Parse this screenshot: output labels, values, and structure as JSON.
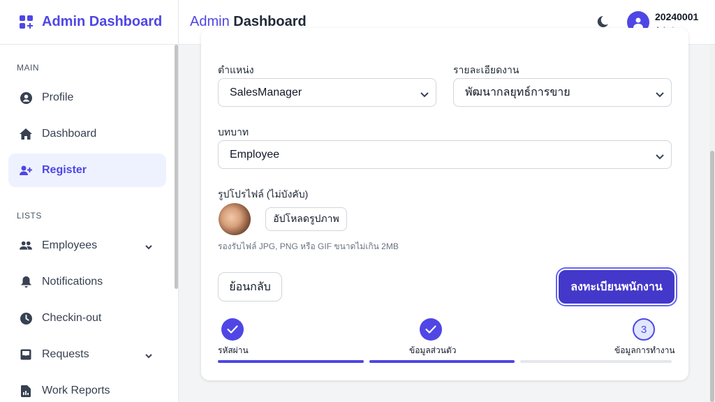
{
  "sidebar": {
    "brand": "Admin Dashboard",
    "sections": {
      "main": "MAIN",
      "lists": "LISTS"
    },
    "items": [
      {
        "label": "Profile",
        "icon": "user-circle-icon"
      },
      {
        "label": "Dashboard",
        "icon": "home-icon"
      },
      {
        "label": "Register",
        "icon": "user-plus-icon",
        "active": true
      },
      {
        "label": "Employees",
        "icon": "users-icon",
        "has_submenu": true
      },
      {
        "label": "Notifications",
        "icon": "bell-icon"
      },
      {
        "label": "Checkin-out",
        "icon": "clock-icon"
      },
      {
        "label": "Requests",
        "icon": "inbox-icon",
        "has_submenu": true
      },
      {
        "label": "Work Reports",
        "icon": "report-icon"
      }
    ]
  },
  "header": {
    "title_accent": "Admin",
    "title_rest": "Dashboard",
    "user": {
      "id": "20240001",
      "role": "Admin"
    },
    "theme_toggle_icon": "moon-icon"
  },
  "form": {
    "position": {
      "label": "ตำแหน่ง",
      "value": "SalesManager"
    },
    "job_detail": {
      "label": "รายละเอียดงาน",
      "value": "พัฒนากลยุทธ์การขาย"
    },
    "role": {
      "label": "บทบาท",
      "value": "Employee"
    },
    "profile_photo": {
      "label": "รูปโปรไฟล์ (ไม่บังคับ)",
      "upload_label": "อัปโหลดรูปภาพ",
      "hint": "รองรับไฟล์ JPG, PNG หรือ GIF ขนาดไม่เกิน 2MB"
    },
    "back_label": "ย้อนกลับ",
    "submit_label": "ลงทะเบียนพนักงาน"
  },
  "stepper": {
    "steps": [
      {
        "label": "รหัสผ่าน",
        "status": "done",
        "progress": 1.0
      },
      {
        "label": "ข้อมูลส่วนตัว",
        "status": "done",
        "progress": 1.0
      },
      {
        "label": "ข้อมูลการทำงาน",
        "status": "current",
        "number": "3",
        "progress": 0.0
      }
    ]
  },
  "colors": {
    "accent": "#4f46e5",
    "submit": "#4338ca",
    "active_bg": "#eef2ff"
  }
}
